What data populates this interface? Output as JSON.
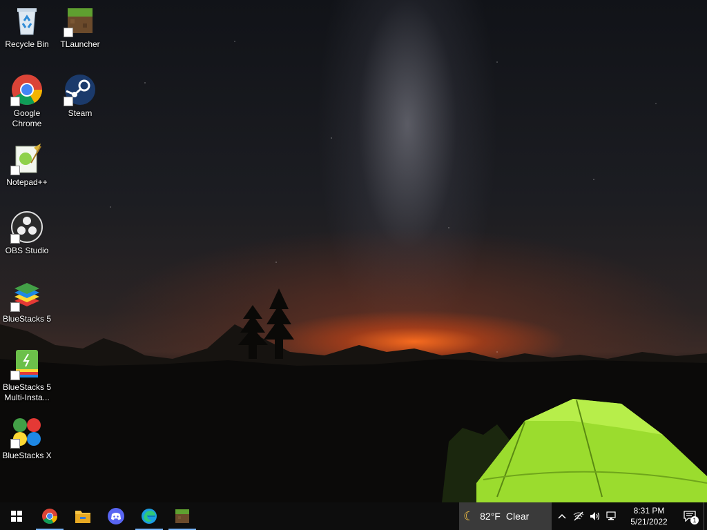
{
  "desktop": {
    "icons": [
      {
        "label": "Recycle Bin",
        "icon": "recycle-bin-icon"
      },
      {
        "label": "TLauncher",
        "icon": "tlauncher-icon"
      },
      {
        "label": "Google Chrome",
        "icon": "chrome-icon"
      },
      {
        "label": "Steam",
        "icon": "steam-icon"
      },
      {
        "label": "Notepad++",
        "icon": "notepadpp-icon"
      },
      {
        "label": "OBS Studio",
        "icon": "obs-icon"
      },
      {
        "label": "BlueStacks 5",
        "icon": "bluestacks5-icon"
      },
      {
        "label": "BlueStacks 5 Multi-Insta...",
        "icon": "bluestacks-multi-icon"
      },
      {
        "label": "BlueStacks X",
        "icon": "bluestacks-x-icon"
      }
    ]
  },
  "taskbar": {
    "pinned": [
      {
        "name": "start",
        "icon": "windows-logo-icon"
      },
      {
        "name": "Google Chrome",
        "icon": "chrome-icon",
        "active": true
      },
      {
        "name": "File Explorer",
        "icon": "folder-icon"
      },
      {
        "name": "Discord",
        "icon": "discord-icon"
      },
      {
        "name": "Microsoft Edge",
        "icon": "edge-icon",
        "active": true
      },
      {
        "name": "TLauncher",
        "icon": "tlauncher-icon",
        "active": true
      }
    ],
    "weather": {
      "temp": "82°F",
      "condition": "Clear",
      "icon": "moon-icon"
    },
    "tray": [
      "chevron-up-icon",
      "network-off-icon",
      "volume-icon",
      "ethernet-icon"
    ],
    "clock": {
      "time": "8:31 PM",
      "date": "5/21/2022"
    },
    "notifications": {
      "count": "1",
      "icon": "action-center-icon"
    }
  },
  "colors": {
    "taskbar": "#0d0d0d",
    "accent": "#7ab7ff",
    "tent": "#9bdc2e"
  }
}
